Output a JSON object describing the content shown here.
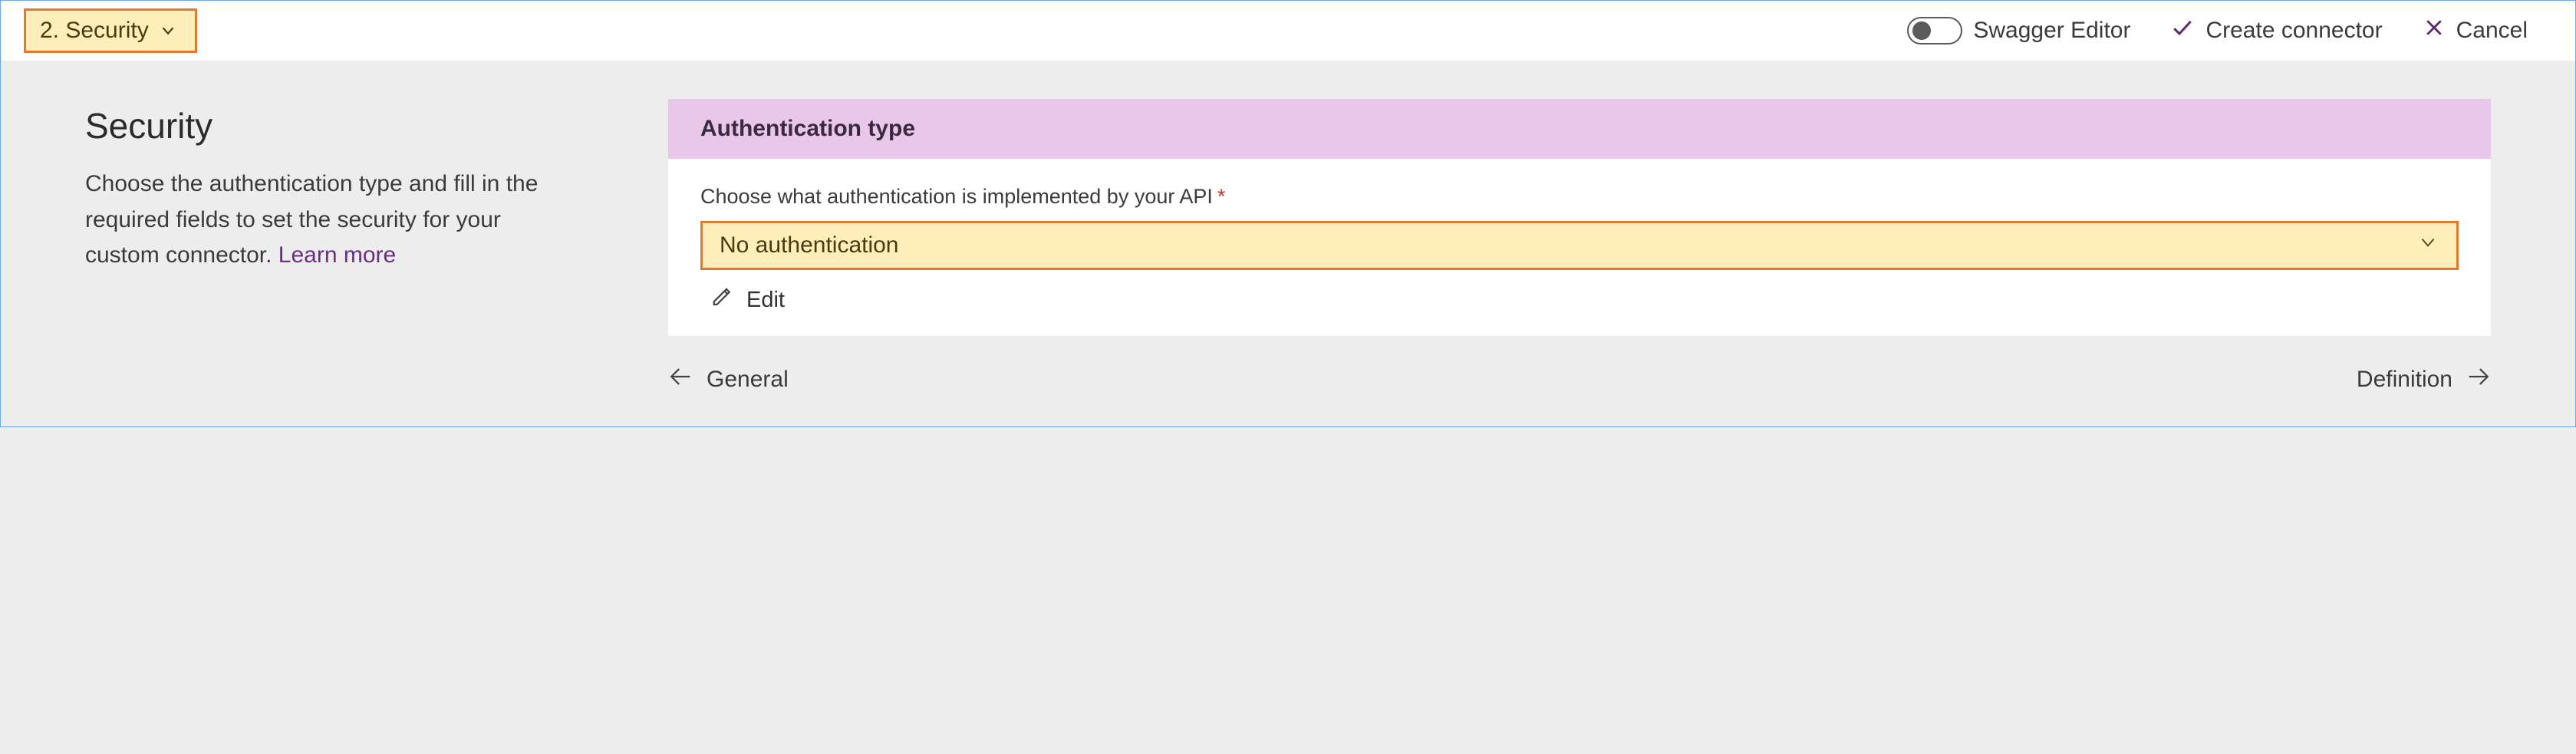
{
  "topbar": {
    "step_label": "2. Security",
    "swagger_label": "Swagger Editor",
    "create_label": "Create connector",
    "cancel_label": "Cancel"
  },
  "left": {
    "title": "Security",
    "description": "Choose the authentication type and fill in the required fields to set the security for your custom connector. ",
    "learn_more": "Learn more"
  },
  "card": {
    "header": "Authentication type",
    "field_label": "Choose what authentication is implemented by your API",
    "required_mark": "*",
    "selected_value": "No authentication",
    "edit_label": "Edit"
  },
  "nav": {
    "prev_label": "General",
    "next_label": "Definition"
  }
}
